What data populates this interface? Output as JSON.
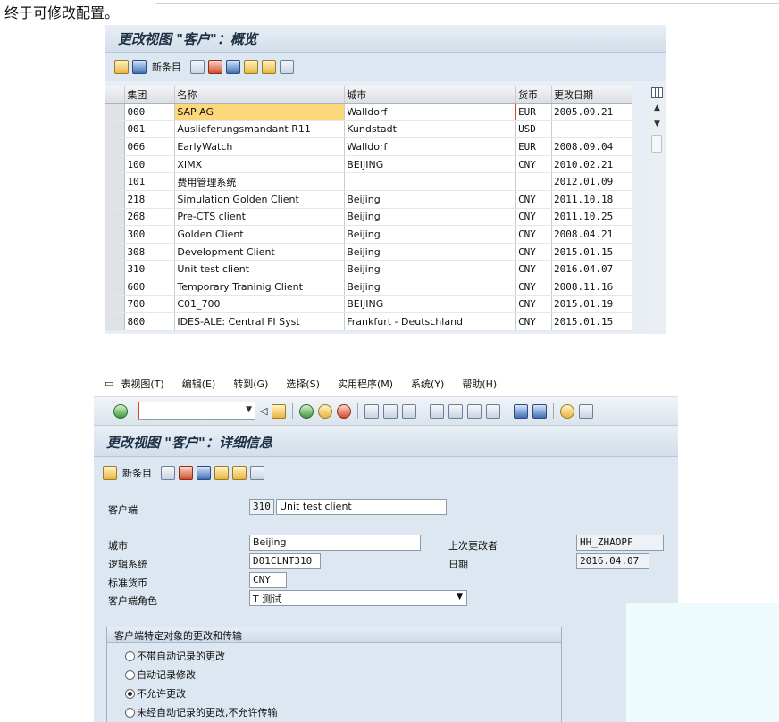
{
  "caption": "终于可修改配置。",
  "overview": {
    "title": "更改视图 \"客户\"：概览",
    "toolbar": {
      "new_entries_label": "新条目",
      "icons": [
        "change-display-icon",
        "find-icon",
        "copy-icon",
        "delete-icon",
        "undo-icon",
        "select-all-icon",
        "select-block-icon",
        "deselect-all-icon"
      ]
    },
    "columns": [
      "集团",
      "名称",
      "城市",
      "货币",
      "更改日期"
    ],
    "rows": [
      [
        "000",
        "SAP AG",
        "Walldorf",
        "EUR",
        "2005.09.21"
      ],
      [
        "001",
        "Auslieferungsmandant R11",
        "Kundstadt",
        "USD",
        ""
      ],
      [
        "066",
        "EarlyWatch",
        "Walldorf",
        "EUR",
        "2008.09.04"
      ],
      [
        "100",
        "XIMX",
        "BEIJING",
        "CNY",
        "2010.02.21"
      ],
      [
        "101",
        "费用管理系统",
        "",
        "",
        "2012.01.09"
      ],
      [
        "218",
        "Simulation Golden Client",
        "Beijing",
        "CNY",
        "2011.10.18"
      ],
      [
        "268",
        "Pre-CTS client",
        "Beijing",
        "CNY",
        "2011.10.25"
      ],
      [
        "300",
        "Golden Client",
        "Beijing",
        "CNY",
        "2008.04.21"
      ],
      [
        "308",
        "Development Client",
        "Beijing",
        "CNY",
        "2015.01.15"
      ],
      [
        "310",
        "Unit test client",
        "Beijing",
        "CNY",
        "2016.04.07"
      ],
      [
        "600",
        "Temporary Traninig Client",
        "Beijing",
        "CNY",
        "2008.11.16"
      ],
      [
        "700",
        "C01_700",
        "BEIJING",
        "CNY",
        "2015.01.19"
      ],
      [
        "800",
        "IDES-ALE: Central FI Syst",
        "Frankfurt - Deutschland",
        "CNY",
        "2015.01.15"
      ]
    ]
  },
  "details": {
    "menu": [
      "表视图(T)",
      "编辑(E)",
      "转到(G)",
      "选择(S)",
      "实用程序(M)",
      "系统(Y)",
      "帮助(H)"
    ],
    "command_field": "",
    "title": "更改视图 \"客户\"：详细信息",
    "new_entries_label": "新条目",
    "client_label": "客户端",
    "client_no": "310",
    "client_name": "Unit test client",
    "city_label": "城市",
    "city": "Beijing",
    "logical_system_label": "逻辑系统",
    "logical_system": "D01CLNT310",
    "currency_label": "标准货币",
    "currency": "CNY",
    "role_label": "客户端角色",
    "role": "T 测试",
    "changed_by_label": "上次更改者",
    "changed_by": "HH_ZHAOPF",
    "date_label": "日期",
    "date": "2016.04.07",
    "group_title": "客户端特定对象的更改和传输",
    "options": [
      {
        "label": "不带自动记录的更改",
        "checked": false
      },
      {
        "label": "自动记录修改",
        "checked": false
      },
      {
        "label": "不允许更改",
        "checked": true
      },
      {
        "label": "未经自动记录的更改,不允许传输",
        "checked": false
      }
    ]
  }
}
